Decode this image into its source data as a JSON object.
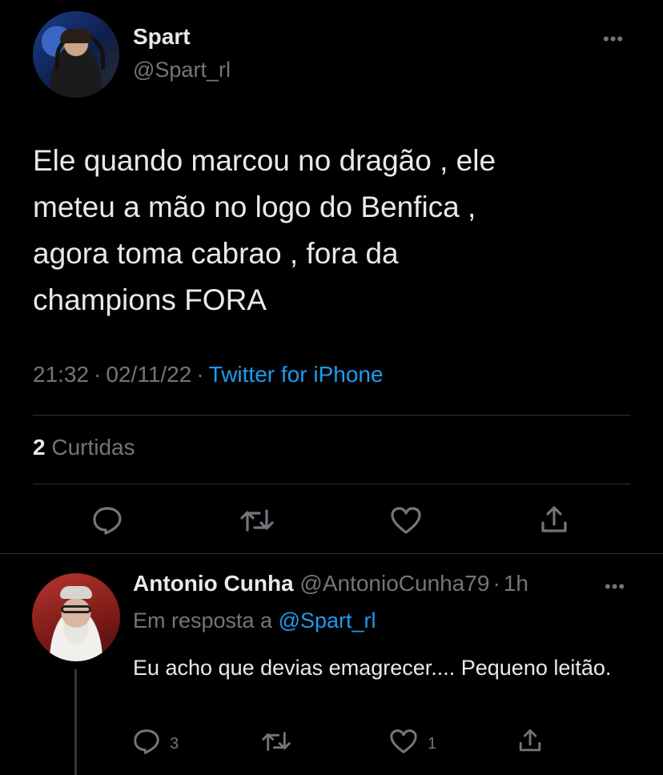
{
  "tweet": {
    "author_name": "Spart",
    "author_handle": "@Spart_rl",
    "text": "Ele quando marcou no dragão , ele\nmeteu a mão no logo do Benfica ,\nagora toma cabrao , fora da\nchampions FORA",
    "time": "21:32",
    "date": "02/11/22",
    "separator": "·",
    "source": "Twitter for iPhone",
    "likes_count": "2",
    "likes_label": "Curtidas",
    "more_icon": "more-dots-icon"
  },
  "reply": {
    "author_name": "Antonio Cunha",
    "author_handle": "@AntonioCunha79",
    "time_ago": "1h",
    "separator": "·",
    "in_reply_prefix": "Em resposta a",
    "in_reply_handle": "@Spart_rl",
    "text": "Eu acho que devias emagrecer.... Pequeno leitão.",
    "reply_count": "3",
    "like_count": "1"
  },
  "colors": {
    "background": "#000000",
    "text": "#e7e9ea",
    "muted": "#71767b",
    "link": "#1d9bf0",
    "divider": "#2f3336"
  }
}
